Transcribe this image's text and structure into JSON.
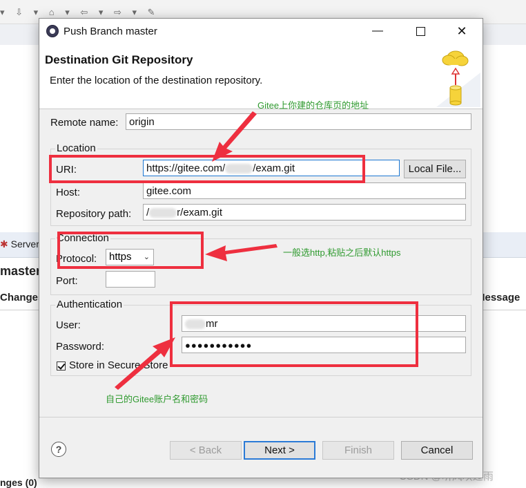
{
  "background": {
    "servers_tab": "Server",
    "branch_heading": "master",
    "changes_header": "Changes",
    "message_header": "Message",
    "changes_bottom": "nges (0)",
    "watermark": "CSDN @听风吹过雨"
  },
  "dialog": {
    "title": "Push Branch master",
    "header_title": "Destination Git Repository",
    "header_subtitle": "Enter the location of the destination repository.",
    "remote_name_label": "Remote name:",
    "remote_name_value": "origin",
    "location_group": "Location",
    "uri_label": "URI:",
    "uri_prefix": "https://gitee.com/",
    "uri_suffix": "/exam.git",
    "local_file_button": "Local File...",
    "host_label": "Host:",
    "host_value": "gitee.com",
    "repo_path_label": "Repository path:",
    "repo_path_prefix": "/",
    "repo_path_suffix": "r/exam.git",
    "connection_group": "Connection",
    "protocol_label": "Protocol:",
    "protocol_value": "https",
    "port_label": "Port:",
    "port_value": "",
    "auth_group": "Authentication",
    "user_label": "User:",
    "user_suffix": "mr",
    "password_label": "Password:",
    "password_value": "●●●●●●●●●●●",
    "store_label": "Store in Secure Store",
    "store_checked": true,
    "buttons": {
      "back": "< Back",
      "next": "Next >",
      "finish": "Finish",
      "cancel": "Cancel"
    }
  },
  "annotations": {
    "uri_note": "Gitee上你建的仓库页的地址",
    "protocol_note": "一般选http,粘贴之后默认https",
    "auth_note": "自己的Gitee账户名和密码"
  },
  "colors": {
    "annotation_red": "#ee2f3f",
    "annotation_green": "#2f9a2f",
    "focus_blue": "#1a76d2"
  }
}
